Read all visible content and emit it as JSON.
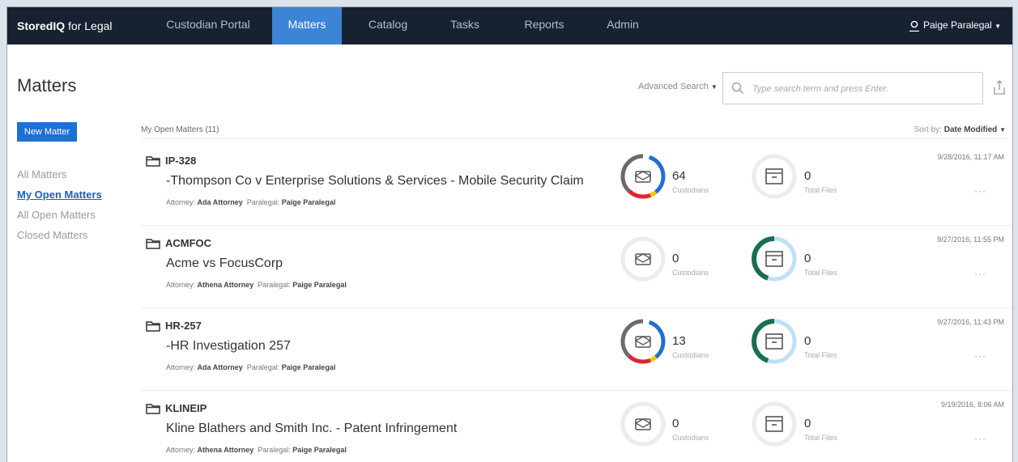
{
  "app": {
    "brand_bold": "StoredIQ",
    "brand_rest": " for Legal"
  },
  "nav": [
    {
      "label": "Custodian Portal"
    },
    {
      "label": "Matters",
      "active": true
    },
    {
      "label": "Catalog"
    },
    {
      "label": "Tasks"
    },
    {
      "label": "Reports"
    },
    {
      "label": "Admin"
    }
  ],
  "user": {
    "name": "Paige Paralegal",
    "icon": "user-icon"
  },
  "page": {
    "title": "Matters"
  },
  "search": {
    "advanced_label": "Advanced Search",
    "placeholder": "Type search term and press Enter."
  },
  "sidebar": {
    "new_matter_label": "New Matter",
    "links": [
      "All Matters",
      "My Open Matters",
      "All Open Matters",
      "Closed Matters"
    ],
    "active_index": 1
  },
  "list": {
    "header": "My Open Matters (11)",
    "sort_label": "Sort by:",
    "sort_value": "Date Modified"
  },
  "labels": {
    "attorney": "Attorney:",
    "paralegal": "Paralegal:",
    "custodians": "Custodians",
    "total_files": "Total Files",
    "more": "···"
  },
  "colors": {
    "nav_bg": "#182131",
    "accent": "#3c85d6",
    "button": "#1d71d3",
    "ring_gray": "#6b6b6b",
    "ring_blue": "#1f6fd0",
    "ring_red": "#e0242e",
    "ring_yellow": "#f5c400",
    "ring_green": "#1a6e52",
    "ring_lightblue": "#bfe0f5",
    "ring_empty": "#ececec"
  },
  "matters": [
    {
      "id": "IP-328",
      "name": "-Thompson Co v Enterprise Solutions & Services - Mobile Security Claim",
      "attorney": "Ada Attorney",
      "paralegal": "Paige Paralegal",
      "custodians": "64",
      "files": "0",
      "date": "9/28/2016, 11:17 AM",
      "custodian_ring": "multi",
      "files_ring": "empty"
    },
    {
      "id": "ACMFOC",
      "name": "Acme vs FocusCorp",
      "attorney": "Athena Attorney",
      "paralegal": "Paige Paralegal",
      "custodians": "0",
      "files": "0",
      "date": "9/27/2016, 11:55 PM",
      "custodian_ring": "empty",
      "files_ring": "green"
    },
    {
      "id": "HR-257",
      "name": "-HR Investigation 257",
      "attorney": "Ada Attorney",
      "paralegal": "Paige Paralegal",
      "custodians": "13",
      "files": "0",
      "date": "9/27/2016, 11:43 PM",
      "custodian_ring": "multi",
      "files_ring": "green"
    },
    {
      "id": "KLINEIP",
      "name": "Kline Blathers and Smith Inc. - Patent Infringement",
      "attorney": "Athena Attorney",
      "paralegal": "Paige Paralegal",
      "custodians": "0",
      "files": "0",
      "date": "9/19/2016, 8:06 AM",
      "custodian_ring": "empty",
      "files_ring": "empty"
    }
  ]
}
